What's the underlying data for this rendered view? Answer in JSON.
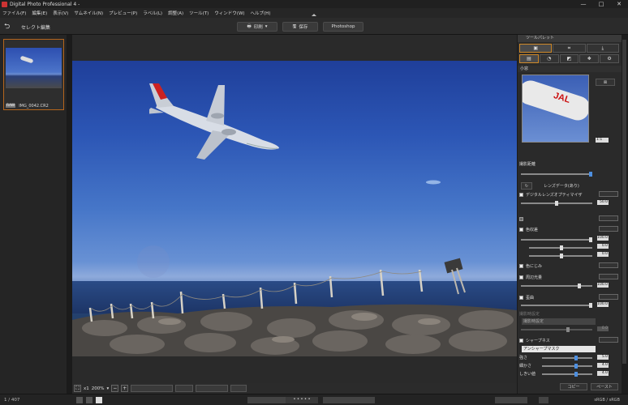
{
  "window": {
    "title": "Digital Photo Professional 4 -",
    "controls": [
      "—",
      "□",
      "✕"
    ]
  },
  "menu": [
    "ファイル(F)",
    "編集(E)",
    "表示(V)",
    "サムネイル(N)",
    "プレビュー(P)",
    "ラベル(L)",
    "調整(A)",
    "ツール(T)",
    "ウィンドウ(W)",
    "ヘルプ(H)"
  ],
  "toolbar": {
    "mode_label": "セレクト編集",
    "print_label": "印刷",
    "save_label": "保存",
    "photoshop_label": "Photoshop"
  },
  "filmstrip": {
    "file_name": "IMG_0042.CR2",
    "tag": "RAW"
  },
  "viewer_bar": {
    "zoom_mult": "x1",
    "zoom": "200%"
  },
  "status": {
    "count": "1 / 407",
    "colorspace": "sRGB / sRGB"
  },
  "palette": {
    "header": "ツールパレット",
    "nav_title": "小窓",
    "zoom_value": "1:1",
    "shooting_distance": "撮影距離",
    "lens_data": "レンズデータ(あり)",
    "dlo": "デジタルレンズオプティマイザ",
    "dlo_value": "50.0",
    "aberration": "色収差",
    "aberration_values": [
      "100.0",
      "0.0",
      "0.0"
    ],
    "color_blur": "色にじみ",
    "vignetting": "周辺光量",
    "vignetting_value": "100.0",
    "distortion": "歪曲",
    "distortion_value": "100.0",
    "shooting_setting": "撮影時設定",
    "distortion_field": "撮影時設定",
    "zero": "0.0",
    "sharpness": "シャープネス",
    "unsharp": "アンシャープマスク",
    "strength": "強さ",
    "strength_value": "5.0",
    "fineness": "細かさ",
    "fineness_value": "4.0",
    "threshold": "しきい値",
    "threshold_value": "4.0",
    "copy": "コピー",
    "paste": "ペースト"
  }
}
